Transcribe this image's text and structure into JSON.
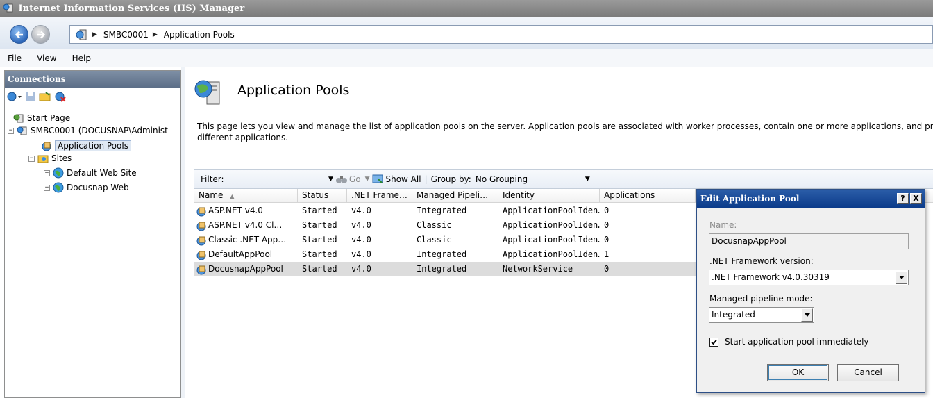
{
  "window": {
    "title": "Internet Information Services (IIS) Manager"
  },
  "address": {
    "crumbs": [
      "SMBC0001",
      "Application Pools"
    ]
  },
  "menu": {
    "items": [
      "File",
      "View",
      "Help"
    ]
  },
  "connections": {
    "header": "Connections",
    "tree": {
      "start_page": "Start Page",
      "server": "SMBC0001 (DOCUSNAP\\Administ",
      "app_pools": "Application Pools",
      "sites": "Sites",
      "site1": "Default Web Site",
      "site2": "Docusnap Web"
    }
  },
  "main": {
    "title": "Application Pools",
    "description_line1": "This page lets you view and manage the list of application pools on the server. Application pools are associated with worker processes, contain one or more applications, and prov",
    "description_line2": "different applications.",
    "filter": {
      "label": "Filter:",
      "value": "",
      "go": "Go",
      "show_all": "Show All",
      "group_by_label": "Group by:",
      "group_by_value": "No Grouping"
    },
    "columns": [
      "Name",
      ".NET Frame…",
      "Managed Pipeli…",
      "Identity",
      "Applications",
      "Status"
    ],
    "rows": [
      {
        "name": "ASP.NET v4.0",
        "status": "Started",
        "net": "v4.0",
        "pipeline": "Integrated",
        "identity": "ApplicationPoolIden…",
        "apps": "0"
      },
      {
        "name": "ASP.NET v4.0 Cl…",
        "status": "Started",
        "net": "v4.0",
        "pipeline": "Classic",
        "identity": "ApplicationPoolIden…",
        "apps": "0"
      },
      {
        "name": "Classic .NET App…",
        "status": "Started",
        "net": "v4.0",
        "pipeline": "Classic",
        "identity": "ApplicationPoolIden…",
        "apps": "0"
      },
      {
        "name": "DefaultAppPool",
        "status": "Started",
        "net": "v4.0",
        "pipeline": "Integrated",
        "identity": "ApplicationPoolIden…",
        "apps": "1"
      },
      {
        "name": "DocusnapAppPool",
        "status": "Started",
        "net": "v4.0",
        "pipeline": "Integrated",
        "identity": "NetworkService",
        "apps": "0"
      }
    ]
  },
  "dialog": {
    "title": "Edit Application Pool",
    "help": "?",
    "close": "X",
    "name_label": "Name:",
    "name_value": "DocusnapAppPool",
    "net_label": ".NET Framework version:",
    "net_value": ".NET Framework v4.0.30319",
    "pipeline_label": "Managed pipeline mode:",
    "pipeline_value": "Integrated",
    "start_label": "Start application pool immediately",
    "start_checked": true,
    "ok": "OK",
    "cancel": "Cancel"
  },
  "colors": {
    "dialog_title": "#0b3b8a",
    "selected_row": "#dcdcdc",
    "panel_header": "#5b6d86"
  }
}
